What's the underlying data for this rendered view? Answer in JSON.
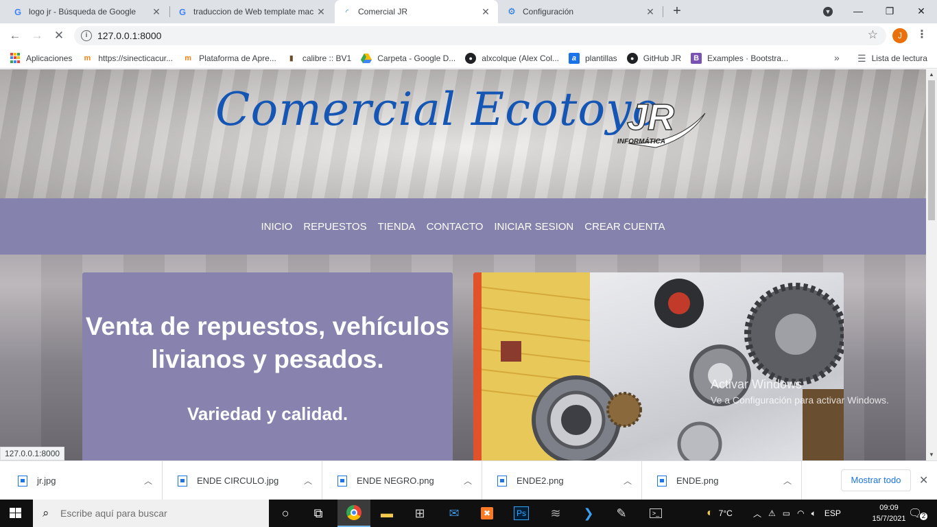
{
  "browser": {
    "tabs": [
      {
        "title": "logo jr - Búsqueda de Google",
        "icon": "google-icon"
      },
      {
        "title": "traduccion de Web template mac",
        "icon": "google-icon"
      },
      {
        "title": "Comercial JR",
        "icon": "loading-icon"
      },
      {
        "title": "Configuración",
        "icon": "gear-icon"
      }
    ],
    "url": "127.0.0.1:8000",
    "profile_initial": "J",
    "bookmarks": [
      {
        "label": "Aplicaciones",
        "icon": "apps-grid-icon"
      },
      {
        "label": "https://sinecticacur...",
        "icon": "moodle-icon"
      },
      {
        "label": "Plataforma de Apre...",
        "icon": "moodle-icon"
      },
      {
        "label": "calibre :: BV1",
        "icon": "calibre-icon"
      },
      {
        "label": "Carpeta - Google D...",
        "icon": "google-drive-icon"
      },
      {
        "label": "alxcolque (Alex Col...",
        "icon": "github-icon"
      },
      {
        "label": "plantillas",
        "icon": "plantillas-icon"
      },
      {
        "label": "GitHub JR",
        "icon": "github-icon"
      },
      {
        "label": "Examples · Bootstra...",
        "icon": "bootstrap-icon"
      }
    ],
    "reading_list": "Lista de lectura",
    "status_url": "127.0.0.1:8000"
  },
  "page": {
    "brand_title": "Comercial Ecotoyo",
    "logo_text": "JR",
    "logo_subtext": "INFORMÁTICA",
    "nav": [
      "INICIO",
      "REPUESTOS",
      "TIENDA",
      "CONTACTO",
      "INICIAR SESION",
      "CREAR CUENTA"
    ],
    "hero_heading": "Venta de repuestos, vehículos livianos y pesados.",
    "hero_subheading": "Variedad y calidad.",
    "nav_color": "#8582ad",
    "brand_color": "#1555b3"
  },
  "windows_watermark": {
    "line1": "Activar Windows",
    "line2": "Ve a Configuración para activar Windows."
  },
  "downloads": {
    "items": [
      "jr.jpg",
      "ENDE CIRCULO.jpg",
      "ENDE NEGRO.png",
      "ENDE2.png",
      "ENDE.png"
    ],
    "show_all": "Mostrar todo"
  },
  "taskbar": {
    "search_placeholder": "Escribe aquí para buscar",
    "weather": "7°C",
    "language": "ESP",
    "time": "09:09",
    "date": "15/7/2021",
    "notifications": "2"
  }
}
